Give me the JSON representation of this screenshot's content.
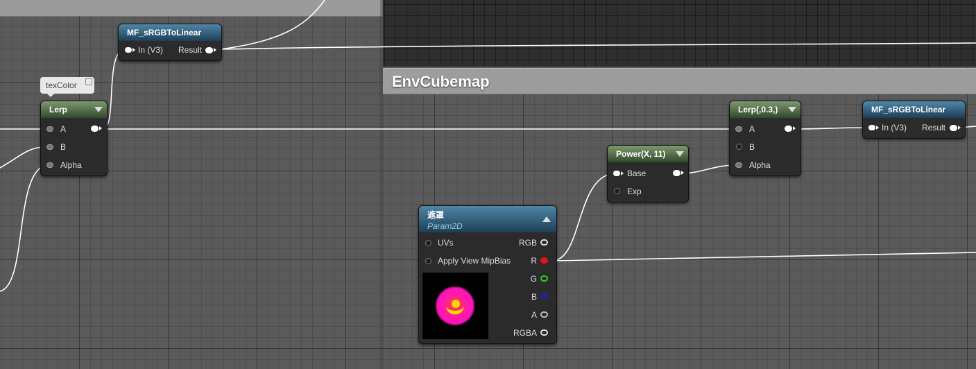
{
  "comment_box": {
    "title": "EnvCubemap"
  },
  "comment_bubble": {
    "text": "texColor"
  },
  "node_srgb_top": {
    "title": "MF_sRGBToLinear",
    "input": "In (V3)",
    "output": "Result"
  },
  "node_lerp_left": {
    "title": "Lerp",
    "inputs": [
      "A",
      "B",
      "Alpha"
    ]
  },
  "node_power": {
    "title": "Power(X, 11)",
    "inputs": [
      "Base",
      "Exp"
    ]
  },
  "node_lerp_right": {
    "title": "Lerp(,0.3,)",
    "inputs": [
      "A",
      "B",
      "Alpha"
    ]
  },
  "node_srgb_right": {
    "title": "MF_sRGBToLinear",
    "input": "In (V3)",
    "output": "Result"
  },
  "node_texture": {
    "title": "遮罩",
    "subtitle": "Param2D",
    "inputs": [
      "UVs",
      "Apply View MipBias"
    ],
    "outputs": [
      "RGB",
      "R",
      "G",
      "B",
      "A",
      "RGBA"
    ],
    "pin_colors": {
      "R": "#e01414",
      "G": "#1fd21f",
      "B": "#1a22c8",
      "A": "#bbbbbb"
    }
  },
  "colors": {
    "wire": "#ffffff",
    "node_header_blue": "#2c5a78",
    "node_header_green": "#4f6a45",
    "comment_header": "#9d9d9d"
  }
}
